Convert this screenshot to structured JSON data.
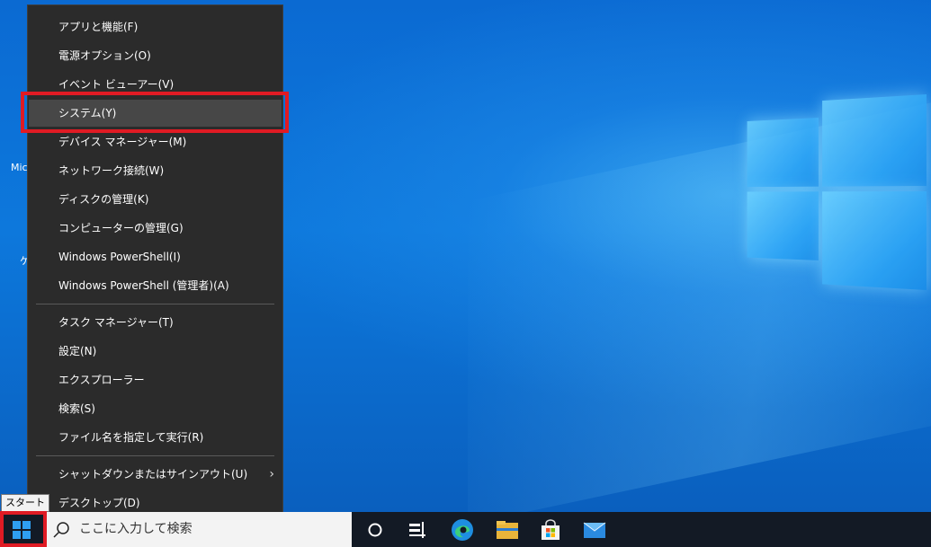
{
  "menu": {
    "items": [
      {
        "label": "アプリと機能(F)"
      },
      {
        "label": "電源オプション(O)"
      },
      {
        "label": "イベント ビューアー(V)"
      },
      {
        "label": "システム(Y)"
      },
      {
        "label": "デバイス マネージャー(M)"
      },
      {
        "label": "ネットワーク接続(W)"
      },
      {
        "label": "ディスクの管理(K)"
      },
      {
        "label": "コンピューターの管理(G)"
      },
      {
        "label": "Windows PowerShell(I)"
      },
      {
        "label": "Windows PowerShell (管理者)(A)"
      },
      {
        "label": "タスク マネージャー(T)"
      },
      {
        "label": "設定(N)"
      },
      {
        "label": "エクスプローラー"
      },
      {
        "label": "検索(S)"
      },
      {
        "label": "ファイル名を指定して実行(R)"
      },
      {
        "label": "シャットダウンまたはサインアウト(U)"
      },
      {
        "label": "デスクトップ(D)"
      }
    ],
    "selected_label": "システム(Y)",
    "submenu_chevron": "›"
  },
  "tooltip": {
    "text": "スタート"
  },
  "search": {
    "placeholder": "ここに入力して検索"
  },
  "desktop": {
    "partial_labels": [
      "Mic",
      "ケ"
    ]
  },
  "taskbar": {
    "icons": [
      "cortana-icon",
      "task-view-icon",
      "edge-icon",
      "file-explorer-icon",
      "store-icon",
      "mail-icon"
    ]
  },
  "colors": {
    "highlight": "#e01b24",
    "menu_bg": "#2b2b2b",
    "taskbar_bg": "#131a25",
    "accent": "#2f9ff0"
  }
}
